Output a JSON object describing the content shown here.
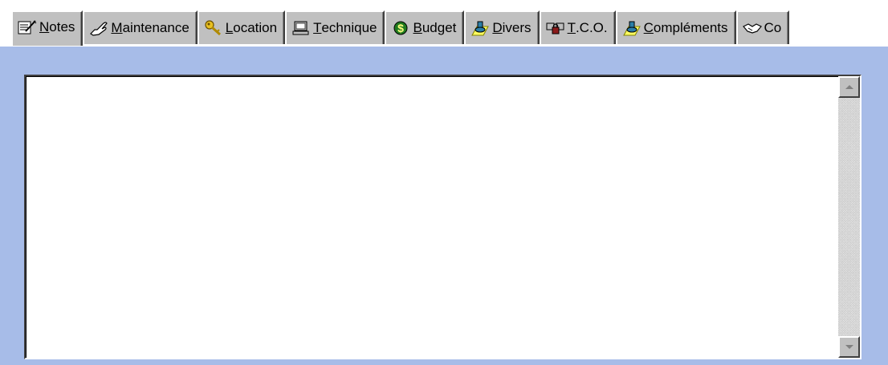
{
  "tabs": [
    {
      "id": "notes",
      "mnemonic": "N",
      "rest": "otes",
      "icon": "notepad-pencil-icon",
      "active": true
    },
    {
      "id": "maintenance",
      "mnemonic": "M",
      "rest": "aintenance",
      "icon": "hand-icon",
      "active": false
    },
    {
      "id": "location",
      "mnemonic": "L",
      "rest": "ocation",
      "icon": "key-icon",
      "active": false
    },
    {
      "id": "technique",
      "mnemonic": "T",
      "rest": "echnique",
      "icon": "computer-icon",
      "active": false
    },
    {
      "id": "budget",
      "mnemonic": "B",
      "rest": "udget",
      "icon": "dollar-icon",
      "active": false
    },
    {
      "id": "divers",
      "mnemonic": "D",
      "rest": "ivers",
      "icon": "stamp-icon",
      "active": false
    },
    {
      "id": "tco",
      "mnemonic": "T",
      "rest": ".C.O.",
      "icon": "locked-computers-icon",
      "active": false
    },
    {
      "id": "complements",
      "mnemonic": "C",
      "rest": "ompléments",
      "icon": "stamp-icon",
      "active": false
    },
    {
      "id": "contrats",
      "mnemonic": "",
      "rest": "Co",
      "icon": "handshake-icon",
      "active": false
    }
  ],
  "notes": {
    "value": ""
  },
  "colors": {
    "panel_background": "#a7bce8",
    "tab_face": "#c0c0c0",
    "text_area": "#ffffff"
  }
}
